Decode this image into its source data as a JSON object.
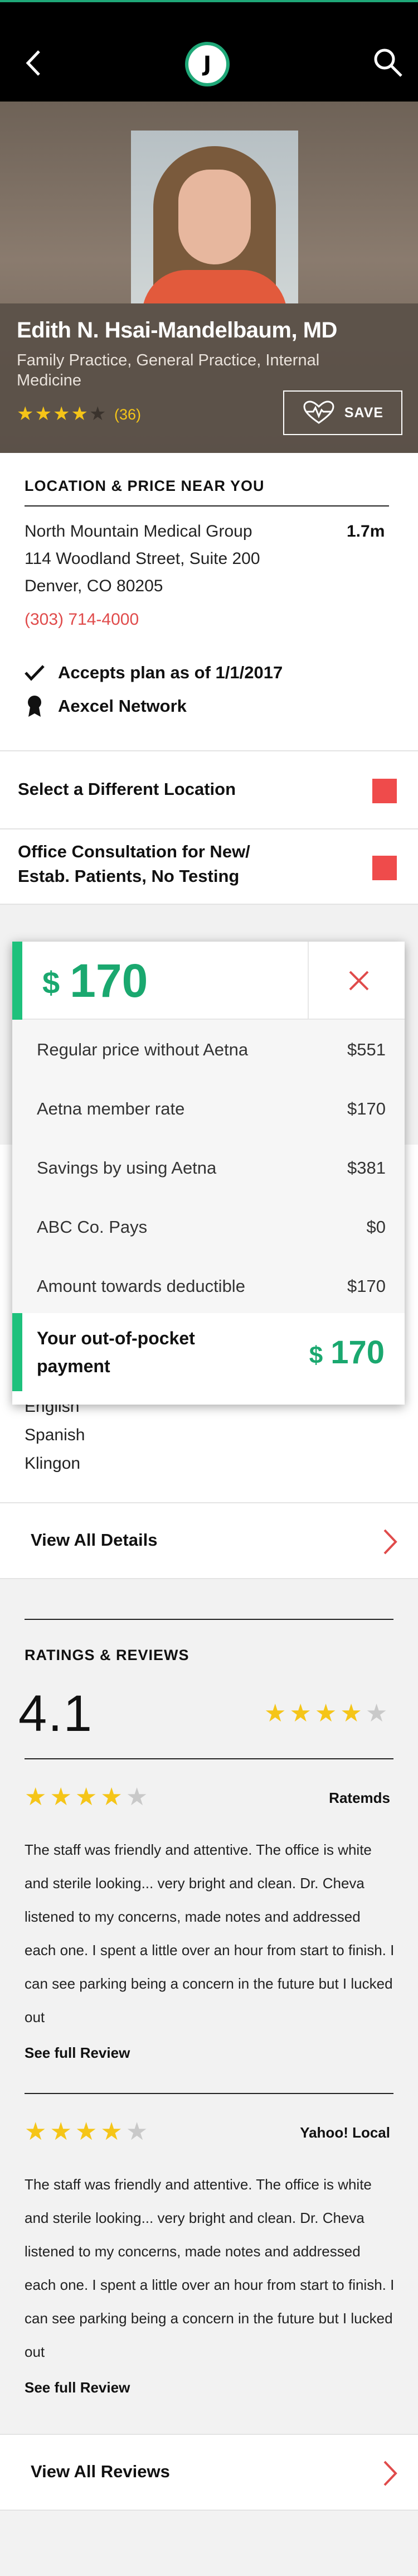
{
  "header": {
    "logo_letter": "J",
    "accent_color": "#1fa878"
  },
  "doctor": {
    "name": "Edith N. Hsai-Mandelbaum, MD",
    "specialty": "Family Practice, General Practice, Internal Medicine",
    "rating_stars": 4,
    "rating_max": 5,
    "review_count": "(36)",
    "save_label": "SAVE"
  },
  "location": {
    "section_title": "LOCATION & PRICE NEAR YOU",
    "group": "North Mountain Medical Group",
    "street": "114 Woodland Street, Suite 200",
    "city": "Denver, CO 80205",
    "distance": "1.7m",
    "phone": "(303) 714-4000",
    "plan_status": "Accepts plan as of 1/1/2017",
    "network": "Aexcel Network"
  },
  "selectors": {
    "location_label": "Select a Different Location",
    "service_label": "Office Consultation for New/ Estab. Patients, No Testing"
  },
  "price_popup": {
    "currency": "$",
    "amount": "170",
    "rows": [
      {
        "label": "Regular price without Aetna",
        "value": "$551"
      },
      {
        "label": "Aetna member rate",
        "value": "$170"
      },
      {
        "label": "Savings by using Aetna",
        "value": "$381"
      },
      {
        "label": "ABC Co. Pays",
        "value": "$0"
      },
      {
        "label": "Amount towards deductible",
        "value": "$170"
      }
    ],
    "out_of_pocket_label": "Your out-of-pocket payment",
    "out_of_pocket_amount": "170"
  },
  "languages": [
    "English",
    "Spanish",
    "Klingon"
  ],
  "details_link": "View All Details",
  "reviews": {
    "section_title": "RATINGS & REVIEWS",
    "average": "4.1",
    "average_stars": 4,
    "items": [
      {
        "stars": 4,
        "source": "Ratemds",
        "text": "The staff was friendly and attentive. The office is white and sterile looking... very bright and clean. Dr. Cheva listened to my concerns, made notes and addressed each one. I spent a little over an hour from start to finish. I can see parking being a concern in the future but I lucked out",
        "link": "See full Review"
      },
      {
        "stars": 4,
        "source": "Yahoo! Local",
        "text": "The staff was friendly and attentive. The office is white and sterile looking... very bright and clean. Dr. Cheva listened to my concerns, made notes and addressed each one. I spent a little over an hour from start to finish. I can see parking being a concern in the future but I lucked out",
        "link": "See full Review"
      }
    ],
    "all_link": "View All Reviews"
  }
}
